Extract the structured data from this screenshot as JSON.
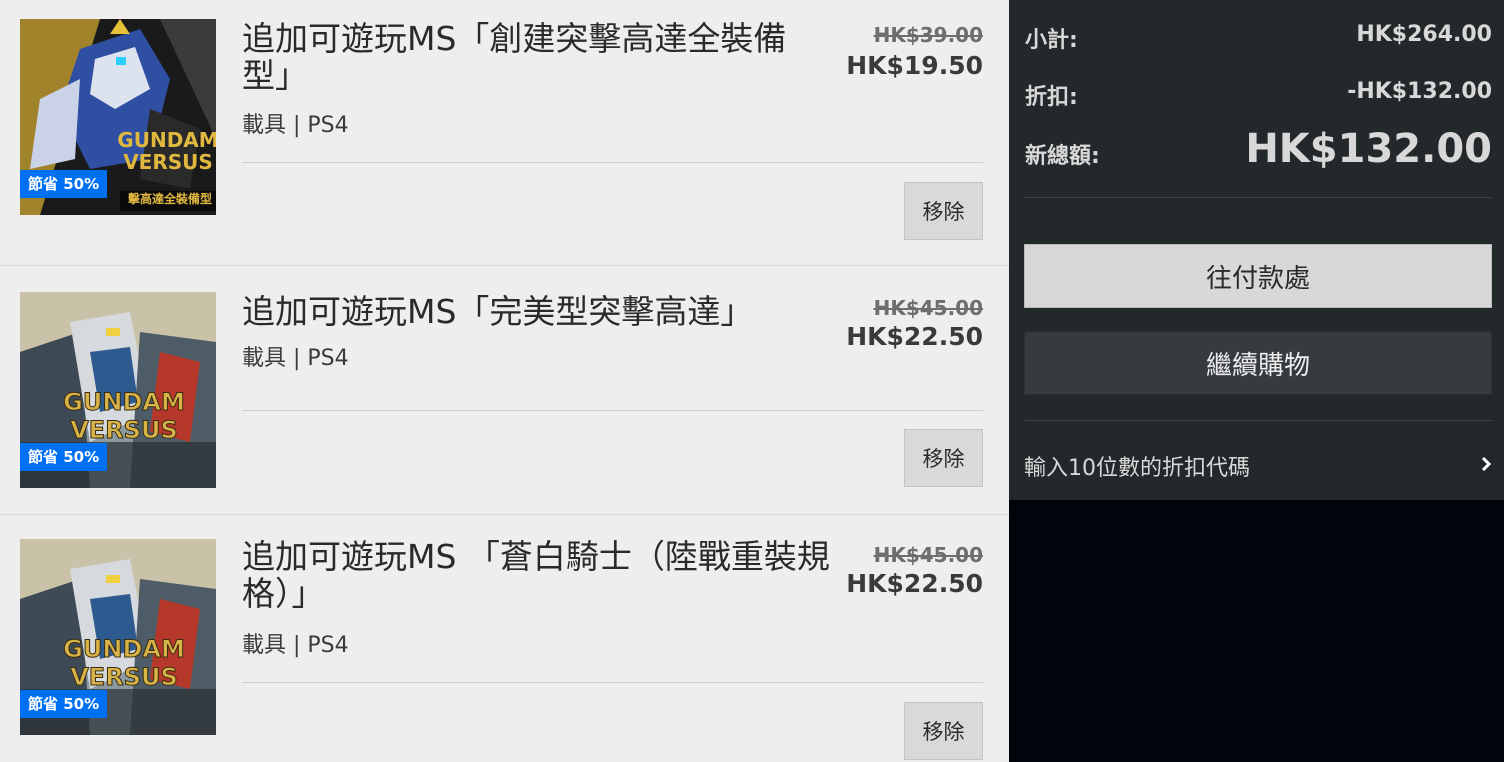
{
  "cart": {
    "items": [
      {
        "title": "追加可遊玩MS「創建突擊高達全裝備型」",
        "meta": "載具 | PS4",
        "original_price": "HK$39.00",
        "sale_price": "HK$19.50",
        "badge": "節省 50%",
        "remove_label": "移除",
        "image_text": [
          "GUNDAM",
          "VERSUS",
          "擊高達全裝備型"
        ],
        "image_theme": "strike-gundam"
      },
      {
        "title": "追加可遊玩MS「完美型突擊高達」",
        "meta": "載具 | PS4",
        "original_price": "HK$45.00",
        "sale_price": "HK$22.50",
        "badge": "節省 50%",
        "remove_label": "移除",
        "image_text": [
          "GUNDAM",
          "VERSUS"
        ],
        "image_theme": "gundam-versus"
      },
      {
        "title": "追加可遊玩MS 「蒼白騎士（陸戰重裝規格）」",
        "meta": "載具 | PS4",
        "original_price": "HK$45.00",
        "sale_price": "HK$22.50",
        "badge": "節省 50%",
        "remove_label": "移除",
        "image_text": [
          "GUNDAM",
          "VERSUS"
        ],
        "image_theme": "gundam-versus"
      }
    ]
  },
  "summary": {
    "subtotal_label": "小計:",
    "subtotal_value": "HK$264.00",
    "discount_label": "折扣:",
    "discount_value": "-HK$132.00",
    "total_label": "新總額:",
    "total_value": "HK$132.00",
    "checkout_label": "往付款處",
    "continue_label": "繼續購物",
    "promo_label": "輸入10位數的折扣代碼",
    "promo_icon": "chevron-right-icon"
  },
  "colors": {
    "badge_blue": "#0070f3",
    "panel_dark": "#23282b",
    "list_bg": "#eeeeee"
  }
}
